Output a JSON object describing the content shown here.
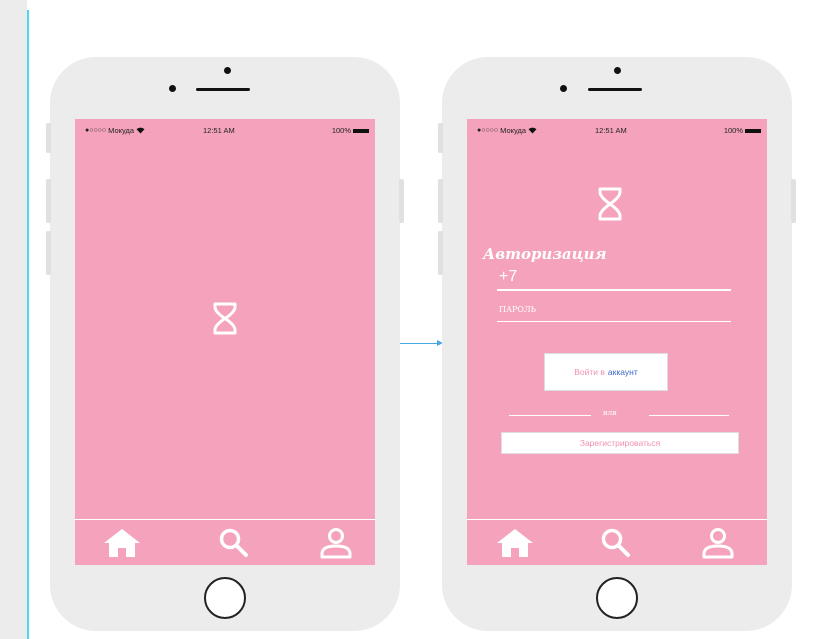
{
  "screen1": {
    "status": {
      "carrier": "Мокуда",
      "time": "12:51 AM",
      "battery": "100%"
    }
  },
  "screen2": {
    "status": {
      "carrier": "Мокуда",
      "time": "12:51 AM",
      "battery": "100%"
    },
    "title": "Авторизация",
    "phone_value": "+7",
    "password_placeholder": "ПАРОЛЬ",
    "login_label": "Войти в",
    "login_label_accent": "аккаунт",
    "or_text": "или",
    "register_label": "Зарегистрироваться"
  },
  "tabbar": {
    "icons": [
      "home-icon",
      "search-icon",
      "user-icon"
    ]
  },
  "colors": {
    "screen_bg": "#f5a3bd",
    "phone_body": "#ececec",
    "accent_link": "#3a68c6",
    "flow_arrow": "#4aa7e0",
    "guide_line": "#4fd6f0"
  }
}
